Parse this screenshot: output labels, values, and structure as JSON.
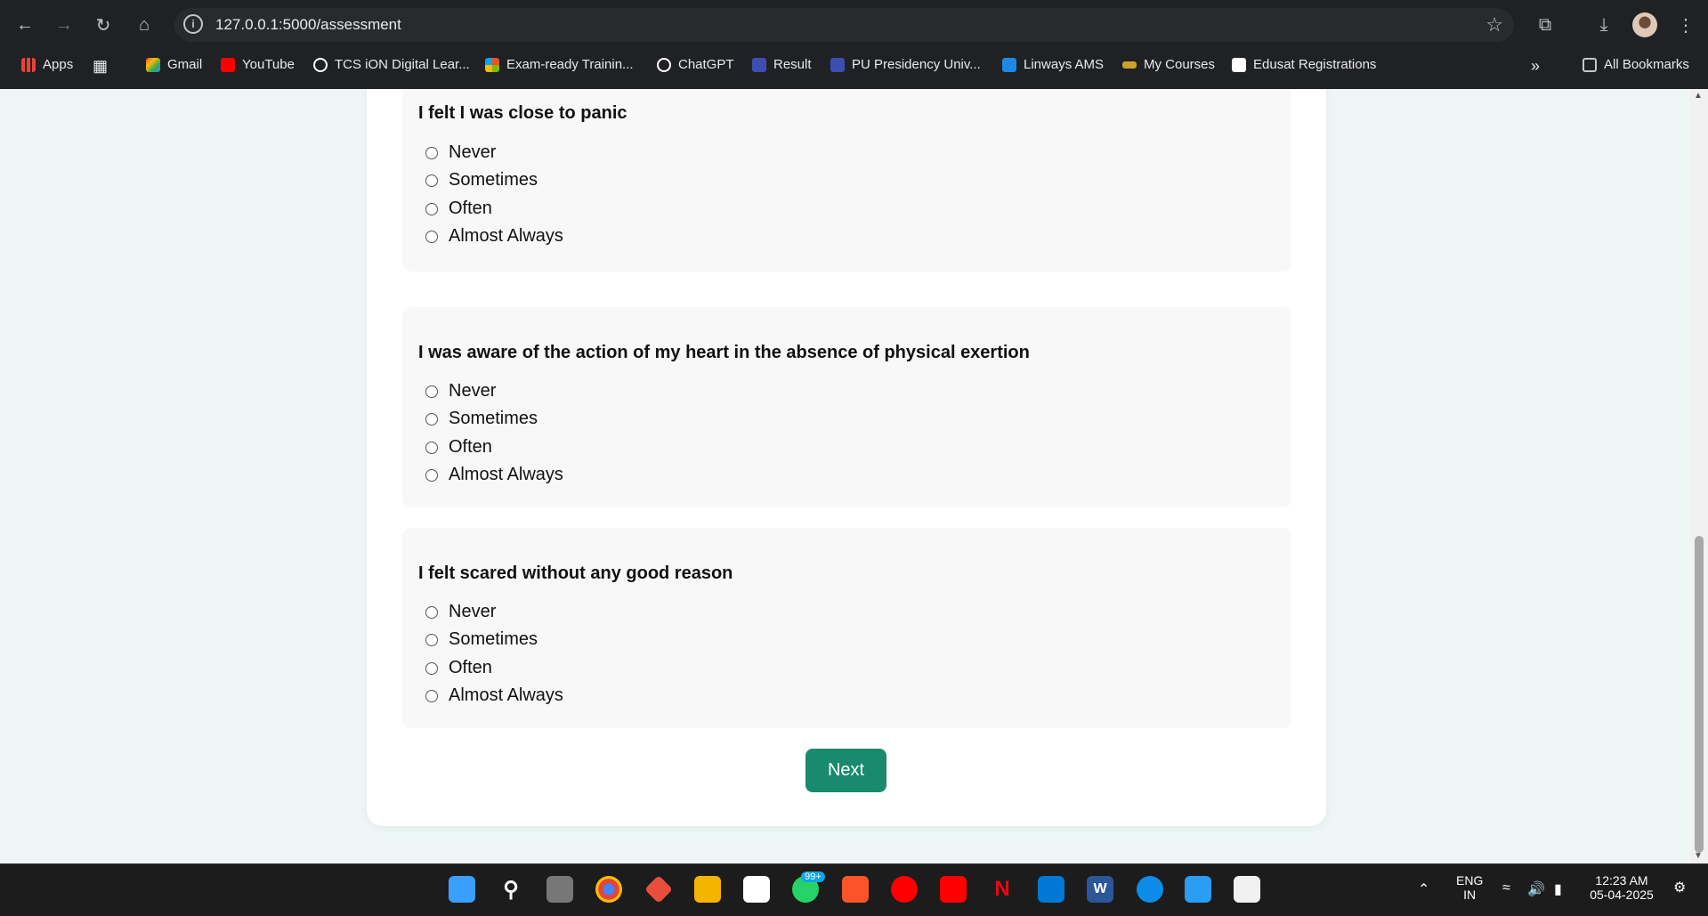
{
  "browser": {
    "url": "127.0.0.1:5000/assessment",
    "bookmarks": [
      {
        "label": "Apps",
        "icon": "apps-grid-icon",
        "color": "#ea4335"
      },
      {
        "label": "Gmail",
        "icon": "gmail-icon",
        "color": "#ea4335"
      },
      {
        "label": "YouTube",
        "icon": "youtube-icon",
        "color": "#ff0000"
      },
      {
        "label": "TCS iON Digital Lear...",
        "icon": "tcs-ion-icon",
        "color": "#ffffff"
      },
      {
        "label": "Exam-ready Trainin...",
        "icon": "microsoft-icon",
        "color": "#f25022"
      },
      {
        "label": "ChatGPT",
        "icon": "chatgpt-icon",
        "color": "#ffffff"
      },
      {
        "label": "Result",
        "icon": "result-icon",
        "color": "#3c4fb0"
      },
      {
        "label": "PU Presidency Univ...",
        "icon": "pu-icon",
        "color": "#3c4fb0"
      },
      {
        "label": "Linways AMS",
        "icon": "linways-icon",
        "color": "#1e88e5"
      },
      {
        "label": "My Courses",
        "icon": "courses-icon",
        "color": "#c9a227"
      },
      {
        "label": "Edusat Registrations",
        "icon": "edusat-icon",
        "color": "#ffffff"
      }
    ],
    "all_bookmarks": "All Bookmarks"
  },
  "questions": [
    {
      "text": "I felt I was close to panic",
      "options": [
        "Never",
        "Sometimes",
        "Often",
        "Almost Always"
      ]
    },
    {
      "text": "I was aware of the action of my heart in the absence of physical exertion",
      "options": [
        "Never",
        "Sometimes",
        "Often",
        "Almost Always"
      ]
    },
    {
      "text": "I felt scared without any good reason",
      "options": [
        "Never",
        "Sometimes",
        "Often",
        "Almost Always"
      ]
    }
  ],
  "next_label": "Next",
  "accent_color": "#198a6d",
  "taskbar": {
    "whatsapp_badge": "99+",
    "lang_line1": "ENG",
    "lang_line2": "IN",
    "time": "12:23 AM",
    "date": "05-04-2025"
  }
}
